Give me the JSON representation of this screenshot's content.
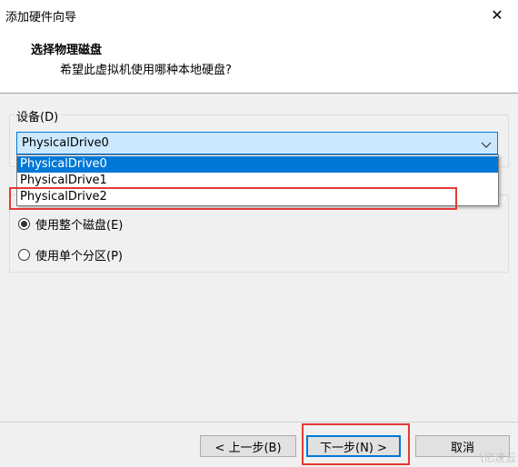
{
  "window": {
    "title": "添加硬件向导",
    "close_glyph": "✕"
  },
  "header": {
    "title": "选择物理磁盘",
    "subtitle": "希望此虚拟机使用哪种本地硬盘?"
  },
  "device_group": {
    "label": "设备(D)"
  },
  "combo": {
    "selected_value": "PhysicalDrive0",
    "options": [
      "PhysicalDrive0",
      "PhysicalDrive1",
      "PhysicalDrive2"
    ],
    "arrow_glyph": "﹀"
  },
  "usage": {
    "options": [
      {
        "label": "使用整个磁盘(E)",
        "checked": true
      },
      {
        "label": "使用单个分区(P)",
        "checked": false
      }
    ]
  },
  "buttons": {
    "back": "< 上一步(B)",
    "next": "下一步(N) >",
    "cancel": "取消"
  },
  "watermark": "\\亿速云",
  "colors": {
    "accent": "#0078d7",
    "highlight_red": "#e53935",
    "combo_bg": "#cce8ff"
  }
}
